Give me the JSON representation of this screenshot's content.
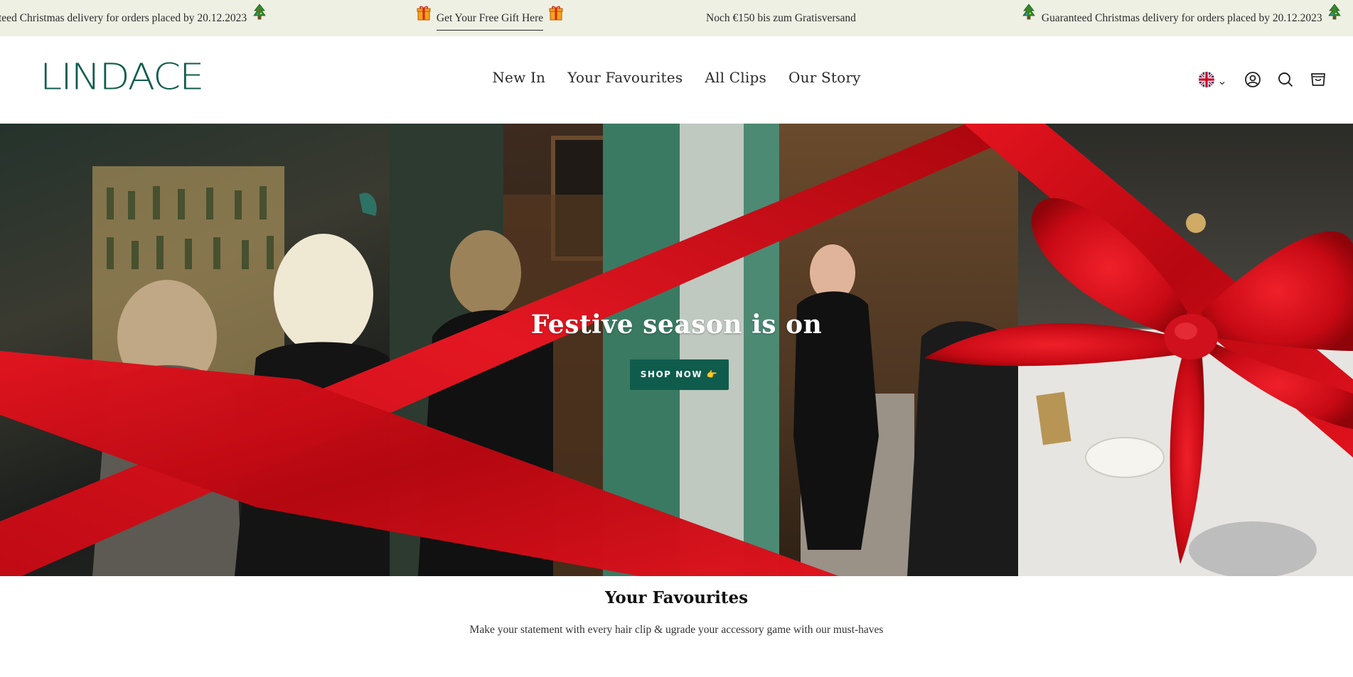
{
  "announcement": {
    "items": [
      {
        "text": "teed Christmas delivery for orders placed by 20.12.2023",
        "icon": "christmas-tree-icon"
      },
      {
        "text": "Get Your Free Gift Here",
        "icon": "gift-icon"
      },
      {
        "text": "Noch €150 bis zum Gratisversand"
      },
      {
        "text": "Guaranteed Christmas delivery for orders placed by 20.12.2023",
        "icon": "christmas-tree-icon"
      }
    ]
  },
  "header": {
    "logo": "LINDACE",
    "nav": [
      "New In",
      "Your Favourites",
      "All Clips",
      "Our Story"
    ],
    "icons": [
      "uk-flag-icon",
      "chevron-down-icon",
      "account-icon",
      "search-icon",
      "cart-icon"
    ]
  },
  "hero": {
    "title": "Festive season is on",
    "button": "SHOP NOW 👉"
  },
  "section": {
    "title": "Your Favourites",
    "subtitle": "Make your statement with every hair clip & ugrade your accessory game with our must-haves"
  },
  "colors": {
    "brand_green": "#0f5c4c",
    "announcement_bg": "#eef0e4",
    "ribbon_red": "#d0101c"
  }
}
